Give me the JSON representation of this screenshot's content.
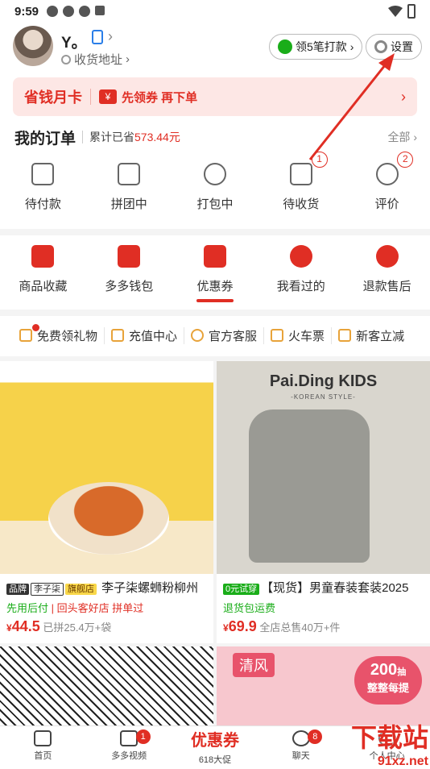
{
  "status": {
    "time": "9:59"
  },
  "profile": {
    "name": "Y。",
    "address": "收货地址"
  },
  "pills": {
    "wechat": "领5笔打款",
    "settings": "设置"
  },
  "month_card": {
    "title": "省钱月卡",
    "coupon_icon": "¥",
    "text": "先领券 再下单"
  },
  "orders": {
    "title": "我的订单",
    "saved_prefix": "累计已省",
    "saved_amount": "573.44元",
    "all": "全部",
    "items": [
      {
        "label": "待付款",
        "icon": "wallet-icon"
      },
      {
        "label": "拼团中",
        "icon": "share-icon"
      },
      {
        "label": "打包中",
        "icon": "clock-icon"
      },
      {
        "label": "待收货",
        "icon": "truck-icon",
        "badge": "1"
      },
      {
        "label": "评价",
        "icon": "review-icon",
        "badge": "2"
      }
    ]
  },
  "tools": [
    {
      "label": "商品收藏",
      "icon": "bag-icon"
    },
    {
      "label": "多多钱包",
      "icon": "wallet-heart-icon"
    },
    {
      "label": "优惠券",
      "icon": "ticket-icon"
    },
    {
      "label": "我看过的",
      "icon": "footprint-icon"
    },
    {
      "label": "退款售后",
      "icon": "refund-icon"
    }
  ],
  "services": [
    {
      "label": "免费领礼物",
      "icon": "gift-icon"
    },
    {
      "label": "充值中心",
      "icon": "recharge-icon"
    },
    {
      "label": "官方客服",
      "icon": "headset-icon"
    },
    {
      "label": "火车票",
      "icon": "train-icon"
    },
    {
      "label": "新客立减",
      "icon": "new-icon"
    }
  ],
  "products": [
    {
      "tag_brand": "品牌",
      "tag_brand_name": "李子柒",
      "tag_flag": "旗舰店",
      "title": "李子柒螺蛳粉柳州",
      "sub_green": "先用后付",
      "sub_red": "回头客好店 拼单过",
      "price_symbol": "¥",
      "price": "44.5",
      "sold": "已拼25.4万+袋"
    },
    {
      "image_brand": "Pai.Ding KIDS",
      "image_sub": "-KOREAN STYLE-",
      "tag_green": "0元试穿",
      "title": "【现货】男童春装套装2025",
      "sub_green": "退货包运费",
      "price_symbol": "¥",
      "price": "69.9",
      "sold": "全店总售40万+件"
    },
    {
      "image": "hangers"
    },
    {
      "image_tag": "清风",
      "bubble_num": "200",
      "bubble_unit": "抽",
      "bubble_text": "整整每提"
    }
  ],
  "tabbar": [
    {
      "label": "首页",
      "icon": "home-icon"
    },
    {
      "label": "多多视频",
      "icon": "video-icon",
      "badge": "1"
    },
    {
      "big": "优惠券",
      "label": "618大促"
    },
    {
      "label": "聊天",
      "icon": "chat-icon",
      "badge": "8"
    },
    {
      "label": "个人中心",
      "icon": "user-icon"
    }
  ],
  "watermark": {
    "line1": "下载站",
    "line2": "91xz.net"
  },
  "colors": {
    "accent": "#e02e24",
    "annotation_arrow": "#e02e24"
  }
}
